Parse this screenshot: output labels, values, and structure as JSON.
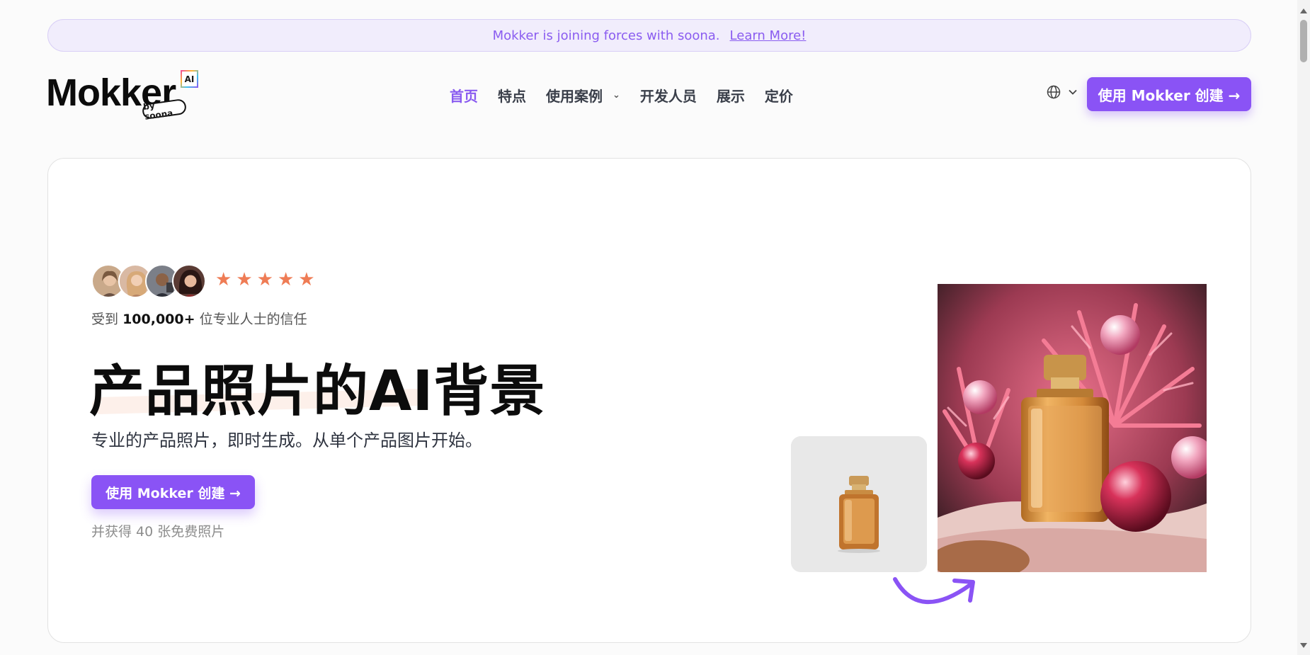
{
  "banner": {
    "text": "Mokker is joining forces with soona.",
    "link": "Learn More!"
  },
  "logo": {
    "wordmark": "Mokker",
    "badge": "AI",
    "byline": "by soona"
  },
  "nav": {
    "items": [
      {
        "label": "首页",
        "active": true
      },
      {
        "label": "特点",
        "active": false
      },
      {
        "label": "使用案例",
        "active": false,
        "dropdown": true
      },
      {
        "label": "开发人员",
        "active": false
      },
      {
        "label": "展示",
        "active": false
      },
      {
        "label": "定价",
        "active": false
      }
    ]
  },
  "header": {
    "cta_label": "使用 Mokker 创建 →",
    "language_icon": "globe-icon"
  },
  "hero": {
    "rating": 5,
    "trust_prefix": "受到",
    "trust_count": "100,000+",
    "trust_suffix": "位专业人士的信任",
    "headline": "产品照片的AI背景",
    "subhead": "专业的产品照片，即时生成。从单个产品图片开始。",
    "cta_label": "使用 Mokker 创建 →",
    "freebie": "并获得 40 张免费照片"
  },
  "colors": {
    "brand": "#8a53f5",
    "star": "#ef7c55",
    "banner_bg": "#f1edfc"
  }
}
